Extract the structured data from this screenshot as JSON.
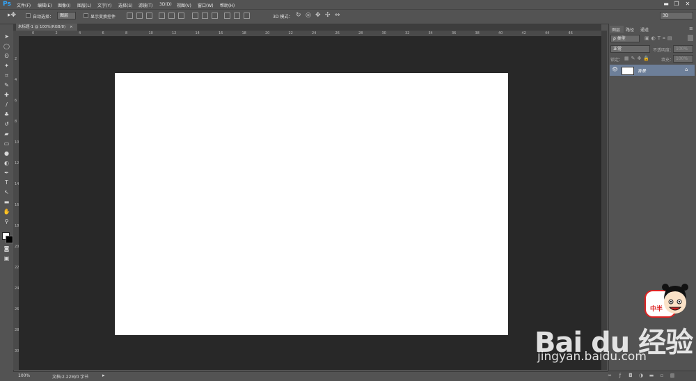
{
  "app": {
    "logo": "Ps"
  },
  "menu": [
    "文件(F)",
    "编辑(E)",
    "图像(I)",
    "图层(L)",
    "文字(Y)",
    "选择(S)",
    "滤镜(T)",
    "3D(D)",
    "视图(V)",
    "窗口(W)",
    "帮助(H)"
  ],
  "options": {
    "auto_select_label": "自动选择：",
    "auto_select_value": "图层",
    "show_transform_label": "显示变换控件",
    "mode_3d_label": "3D 模式：",
    "workspace_value": "3D"
  },
  "document": {
    "tab_title": "未标题-1 @ 100%(RGB/8)",
    "tab_close": "×"
  },
  "rulers": {
    "h": [
      "0",
      "2",
      "4",
      "6",
      "8",
      "10",
      "12",
      "14",
      "16",
      "18",
      "20",
      "22",
      "24",
      "26",
      "28",
      "30",
      "32",
      "34",
      "36",
      "38",
      "40",
      "42",
      "44",
      "46"
    ],
    "v": [
      "2",
      "4",
      "6",
      "8",
      "10",
      "12",
      "14",
      "16",
      "18",
      "20",
      "22",
      "24",
      "26",
      "28",
      "30"
    ]
  },
  "status": {
    "zoom": "100%",
    "doc_info": "文档:2.22M/0 字节"
  },
  "panel": {
    "tabs": [
      "图层",
      "路径",
      "通道"
    ],
    "filter_label": "ρ 类型",
    "blend_mode": "正常",
    "opacity_label": "不透明度：",
    "opacity_value": "100%",
    "lock_label": "锁定：",
    "fill_label": "填充：",
    "fill_value": "100%",
    "layer_name": "背景"
  },
  "watermark": {
    "brand": "Bai du 经验",
    "url": "jingyan.baidu.com",
    "stamp": "中半"
  },
  "colors": {
    "canvas": "#ffffff",
    "workspace": "#282828",
    "ui": "#535353",
    "layer_selected": "#6d7f99"
  }
}
